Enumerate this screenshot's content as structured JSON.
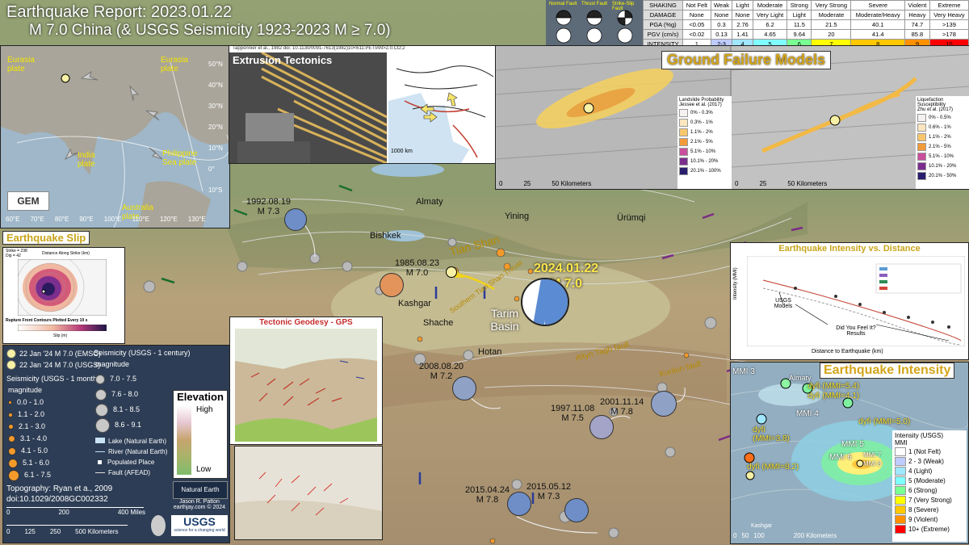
{
  "header": {
    "title": "Earthquake Report: 2023.01.22",
    "subtitle": "M 7.0 China (& USGS Seismicity 1923-2023 M ≥ 7.0)"
  },
  "intensity_scale": {
    "rows": [
      {
        "label": "SHAKING",
        "cells": [
          "Not Felt",
          "Weak",
          "Light",
          "Moderate",
          "Strong",
          "Very Strong",
          "Severe",
          "Violent",
          "Extreme"
        ]
      },
      {
        "label": "DAMAGE",
        "cells": [
          "None",
          "None",
          "None",
          "Very Light",
          "Light",
          "Moderate",
          "Moderate/Heavy",
          "Heavy",
          "Very Heavy"
        ]
      },
      {
        "label": "PGA (%g)",
        "cells": [
          "<0.05",
          "0.3",
          "2.76",
          "6.2",
          "11.5",
          "21.5",
          "40.1",
          "74.7",
          ">139"
        ]
      },
      {
        "label": "PGV (cm/s)",
        "cells": [
          "<0.02",
          "0.13",
          "1.41",
          "4.65",
          "9.64",
          "20",
          "41.4",
          "85.8",
          ">178"
        ]
      }
    ],
    "intensity_label": "INTENSITY",
    "levels": [
      "1",
      "2-3",
      "4",
      "5",
      "6",
      "7",
      "8",
      "9",
      "10"
    ],
    "level_colors": [
      "#ffffff",
      "#bfccff",
      "#a0e6ff",
      "#80ffff",
      "#7aff93",
      "#ffff00",
      "#ffc800",
      "#ff9100",
      "#ff0000"
    ],
    "fault_types": [
      "Normal Fault",
      "Thrust Fault",
      "Strike-Slip Fault"
    ]
  },
  "inset_tectonics": {
    "plates": [
      "Eurasia plate",
      "Eurasia plate",
      "India plate",
      "Philippine Sea plate",
      "Australia plate"
    ],
    "lat_ticks": [
      "50°N",
      "40°N",
      "30°N",
      "20°N",
      "10°N",
      "0°",
      "10°S"
    ],
    "lon_ticks": [
      "60°E",
      "70°E",
      "80°E",
      "90°E",
      "100°E",
      "110°E",
      "120°E",
      "130°E"
    ],
    "logo": "GEM"
  },
  "extrusion": {
    "citation": "Tapponnier et al., 1982 doi: 10.1130/0091-7613(1982)10<611:PETIAN>2.0.CO;2",
    "title": "Extrusion Tectonics",
    "scale": "1000 km"
  },
  "ground_failure": {
    "title": "Ground Failure Models",
    "landslide": {
      "title": "Landslide Probability",
      "source": "Jessee et al. (2017)",
      "items": [
        "0% - 0.3%",
        "0.3% - 1%",
        "1.1% - 2%",
        "2.1% - 5%",
        "5.1% - 10%",
        "10.1% - 20%",
        "20.1% - 100%"
      ]
    },
    "liquefaction": {
      "title": "Liquefaction Susceptibility",
      "source": "Zhu et al. (2017)",
      "items": [
        "0% - 0.5%",
        "0.6% - 1%",
        "1.1% - 2%",
        "2.1% - 5%",
        "5.1% - 10%",
        "10.1% - 20%",
        "20.1% - 50%"
      ]
    },
    "legend_colors": [
      "#f4f1f0",
      "#fbe6c0",
      "#f8c66c",
      "#f29b3a",
      "#c94f9c",
      "#7b2d8e",
      "#2a1e6e"
    ],
    "scale_left": [
      "0",
      "25",
      "50 Kilometers"
    ],
    "scale_right": [
      "0",
      "25",
      "50 Kilometers"
    ]
  },
  "slip": {
    "title": "Earthquake Slip",
    "params": [
      "Strike = 238",
      "Dip = 42"
    ],
    "x_axis": "Distance Along Strike (km)",
    "x_bottom": "Slip (m)",
    "footer": "Rupture Front Contours Plotted Every 10 s"
  },
  "main_map": {
    "cities": [
      "Almaty",
      "Yining",
      "Ürümqi",
      "Bishkek",
      "Kashgar",
      "Shache",
      "Hotan"
    ],
    "regions": [
      "Tian Shan",
      "Southern Tian Shan Thrust",
      "Tarim Basin",
      "Altyn Tagh fault",
      "Kunlun fault"
    ],
    "main_event": {
      "date": "2024.01.22",
      "mag": "M 7.0"
    },
    "historic": [
      {
        "date": "1992.08.19",
        "mag": "M 7.3"
      },
      {
        "date": "1985.08.23",
        "mag": "M 7.0"
      },
      {
        "date": "2008.08.20",
        "mag": "M 7.2"
      },
      {
        "date": "2001.11.14",
        "mag": "M 7.8"
      },
      {
        "date": "1997.11.08",
        "mag": "M 7.5"
      },
      {
        "date": "2015.04.24",
        "mag": "M 7.8"
      },
      {
        "date": "2015.05.12",
        "mag": "M 7.3"
      }
    ]
  },
  "geodesy": {
    "title": "Tectonic Geodesy - GPS"
  },
  "legend": {
    "items": [
      "22 Jan '24 M 7.0 (EMSC)",
      "22 Jan '24 M 7.0 (USGS)"
    ],
    "seis_month": "Seismicity (USGS - 1 month)",
    "magnitude": "magnitude",
    "month_mags": [
      "0.0 - 1.0",
      "1.1 - 2.0",
      "2.1 - 3.0",
      "3.1 - 4.0",
      "4.1 - 5.0",
      "5.1 - 6.0",
      "6.1 - 7.5"
    ],
    "seis_century": "Seismicity (USGS - 1 century)",
    "century_mags": [
      "7.0 - 7.5",
      "7.6 - 8.0",
      "8.1 - 8.5",
      "8.6 - 9.1"
    ],
    "misc": [
      "Lake (Natural Earth)",
      "River (Natural Earth)",
      "Populated Place",
      "Fault (AFEAD)"
    ],
    "elevation": {
      "title": "Elevation",
      "high": "High",
      "low": "Low"
    },
    "topo": "Topography: Ryan et a., 2009",
    "doi": "doi:10.1029/2008GC002332",
    "miles": [
      "0",
      "200",
      "400 Miles"
    ],
    "km": [
      "0",
      "125",
      "250",
      "500 Kilometers"
    ],
    "credit": [
      "Jason R. Patton",
      "earthjay.com © 2024"
    ],
    "natural_earth": "Natural Earth",
    "usgs": "USGS",
    "usgs_tag": "science for a changing world"
  },
  "int_vs_dist": {
    "title": "Earthquake Intensity vs. Distance",
    "y_label": "Intensity (MMI)",
    "x_label": "Distance to Earthquake (km)",
    "ann1": "USGS Models",
    "ann2": "Did You Feel It? Results"
  },
  "eq_intensity": {
    "title": "Earthquake Intensity",
    "mmi_labels": [
      "MMI 3",
      "MMI 4",
      "MMI 5",
      "MMI 6",
      "MMI 7",
      "MMI 8"
    ],
    "dyfi": [
      "dyfi (MMI=5.4)",
      "dyfi (MMI=4.1)",
      "dyfi (MMI=5.0)",
      "dyfi (MMI=3.8)",
      "dyfi (MMI=8.2)"
    ],
    "city_almaty": "Almaty",
    "city_kashgar": "Kashgar",
    "legend_title": "Intensity (USGS)",
    "legend_sub": "MMI",
    "legend_items": [
      "1 (Not Felt)",
      "2 - 3 (Weak)",
      "4 (Light)",
      "5 (Moderate)",
      "6 (Strong)",
      "7 (Very Strong)",
      "8 (Severe)",
      "9 (Violent)",
      "10+ (Extreme)"
    ],
    "legend_colors": [
      "#ffffff",
      "#bfccff",
      "#a0e6ff",
      "#80ffff",
      "#7aff93",
      "#ffff00",
      "#ffc800",
      "#ff9100",
      "#ff0000"
    ],
    "scale": [
      "0",
      "50",
      "100",
      "200 Kilometers"
    ]
  }
}
